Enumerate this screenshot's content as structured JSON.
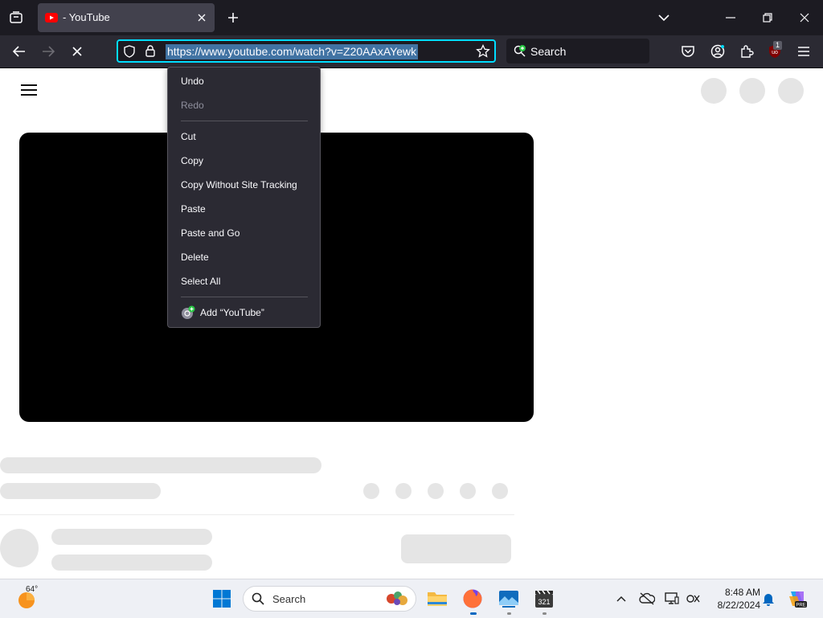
{
  "browser": {
    "tab": {
      "title": "- YouTube"
    },
    "url": "https://www.youtube.com/watch?v=Z20AAxAYewk",
    "search_placeholder": "Search",
    "extension_badge": "1"
  },
  "context_menu": {
    "items": [
      {
        "label": "Undo",
        "enabled": true
      },
      {
        "label": "Redo",
        "enabled": false
      },
      {
        "label": "Cut",
        "enabled": true
      },
      {
        "label": "Copy",
        "enabled": true
      },
      {
        "label": "Copy Without Site Tracking",
        "enabled": true
      },
      {
        "label": "Paste",
        "enabled": true
      },
      {
        "label": "Paste and Go",
        "enabled": true
      },
      {
        "label": "Delete",
        "enabled": true
      },
      {
        "label": "Select All",
        "enabled": true
      },
      {
        "label": "Add “YouTube”",
        "enabled": true,
        "icon": "add-search-engine-icon"
      }
    ]
  },
  "taskbar": {
    "weather_temp": "64°",
    "search_placeholder": "Search",
    "time": "8:48 AM",
    "date": "8/22/2024"
  },
  "colors": {
    "accent_focus": "#00ddff",
    "url_selection": "#4173a3",
    "youtube_red": "#ff0000",
    "windows_blue": "#0067c0"
  }
}
